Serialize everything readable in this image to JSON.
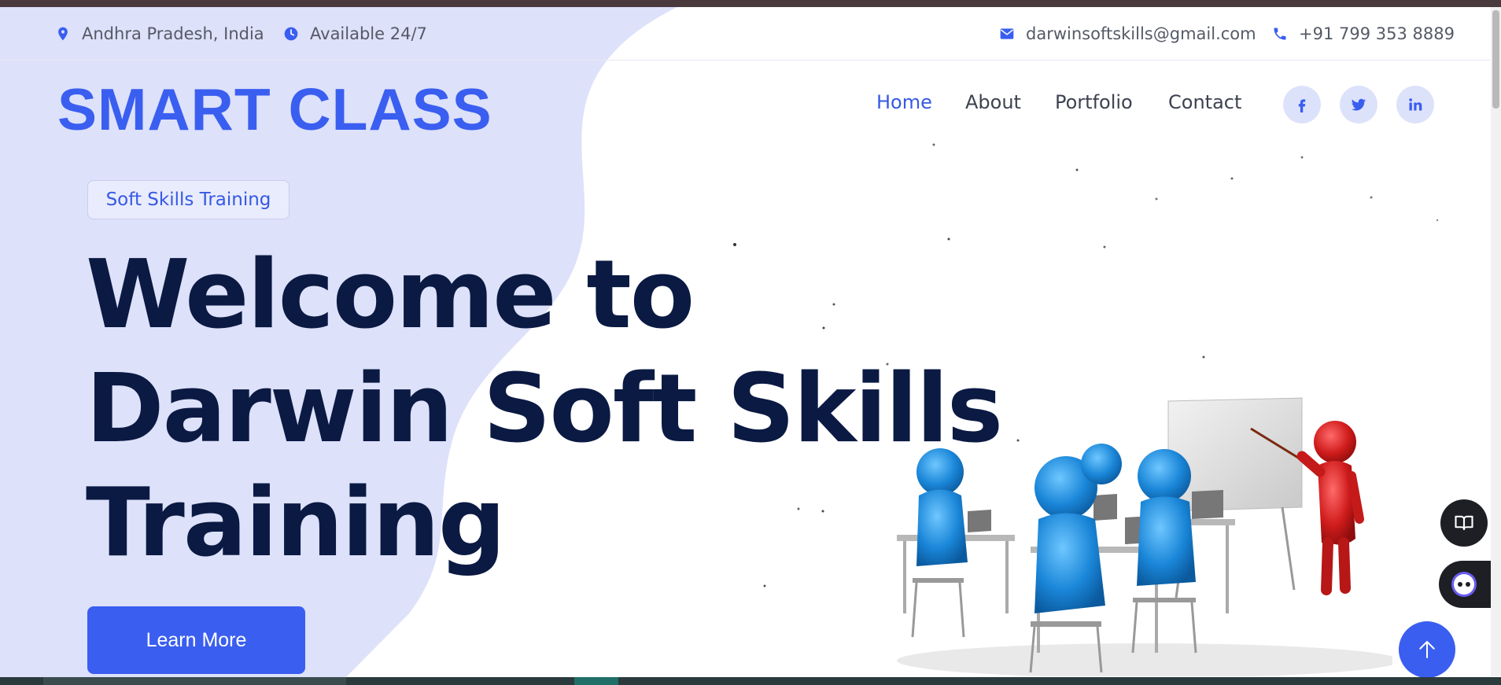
{
  "topbar": {
    "location": "Andhra Pradesh, India",
    "hours": "Available 24/7",
    "email": "darwinsoftskills@gmail.com",
    "phone": "+91 799 353 8889"
  },
  "brand": {
    "logo": "SMART CLASS"
  },
  "nav": {
    "items": [
      {
        "label": "Home",
        "active": true
      },
      {
        "label": "About",
        "active": false
      },
      {
        "label": "Portfolio",
        "active": false
      },
      {
        "label": "Contact",
        "active": false
      }
    ],
    "social": [
      {
        "name": "facebook",
        "icon": "facebook-icon"
      },
      {
        "name": "twitter",
        "icon": "twitter-icon"
      },
      {
        "name": "linkedin",
        "icon": "linkedin-icon"
      }
    ]
  },
  "hero": {
    "badge": "Soft Skills Training",
    "headline_lines": [
      "Welcome to",
      "Darwin Soft Skills",
      "Training"
    ],
    "cta_label": "Learn More",
    "illustration_icon": "classroom-illustration"
  },
  "floating": {
    "reader_icon": "book-icon",
    "assistant_icon": "assistant-bot-icon",
    "back_to_top_icon": "arrow-up-icon"
  },
  "colors": {
    "accent": "#3a5ef0",
    "headline": "#0b1a43",
    "blob": "#dde1fa",
    "top_strip": "#4a3a3e"
  }
}
